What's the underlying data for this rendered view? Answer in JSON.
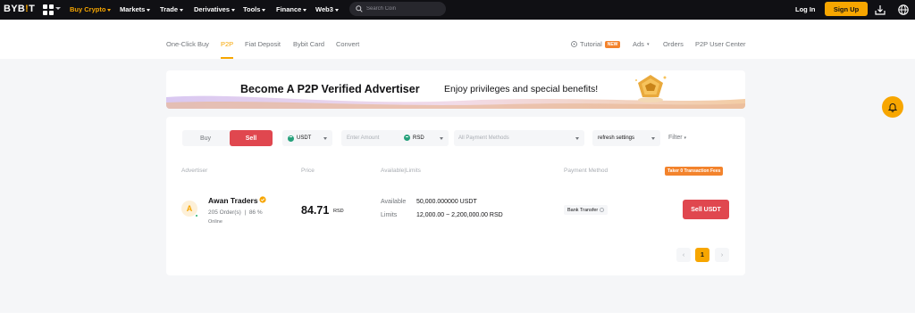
{
  "brand": {
    "logo_main": "BYB",
    "logo_accent": "!",
    "logo_end": "T"
  },
  "nav": {
    "items": [
      "Buy Crypto",
      "Markets",
      "Trade",
      "Derivatives",
      "Tools",
      "Finance",
      "Web3"
    ],
    "search_placeholder": "Search Coin",
    "login": "Log In",
    "signup": "Sign Up"
  },
  "subnav": {
    "left": [
      "One-Click Buy",
      "P2P",
      "Fiat Deposit",
      "Bybit Card",
      "Convert"
    ],
    "tutorial": "Tutorial",
    "new_badge": "NEW",
    "ads": "Ads",
    "orders": "Orders",
    "user_center": "P2P User Center"
  },
  "banner": {
    "title": "Become A P2P Verified Advertiser",
    "subtitle": "Enjoy privileges and special benefits!"
  },
  "filters": {
    "buy": "Buy",
    "sell": "Sell",
    "coin": "USDT",
    "amount_placeholder": "Enter Amount",
    "fiat": "RSD",
    "payment_placeholder": "All Payment Methods",
    "refresh": "refresh settings",
    "filter": "Filter"
  },
  "table": {
    "headers": {
      "advertiser": "Advertiser",
      "price": "Price",
      "available_limits": "Available|Limits",
      "payment": "Payment Method"
    },
    "fee_badge": "Taker 0 Transaction Fees",
    "row": {
      "avatar_letter": "A",
      "name": "Awan Traders",
      "orders": "205 Order(s)",
      "separator": "|",
      "completion": "86 %",
      "status": "Online",
      "price": "84.71",
      "price_unit": "RSD",
      "available_label": "Available",
      "available_value": "50,000.000000 USDT",
      "limits_label": "Limits",
      "limits_value": "12,000.00 ~ 2,200,000.00 RSD",
      "payment": "Bank Transfer",
      "action": "Sell USDT"
    }
  },
  "pagination": {
    "prev": "‹",
    "current": "1",
    "next": "›"
  },
  "colors": {
    "accent": "#f7a600",
    "sell": "#e0474f",
    "nav_bg": "#101014",
    "badge_orange": "#f3832c"
  }
}
